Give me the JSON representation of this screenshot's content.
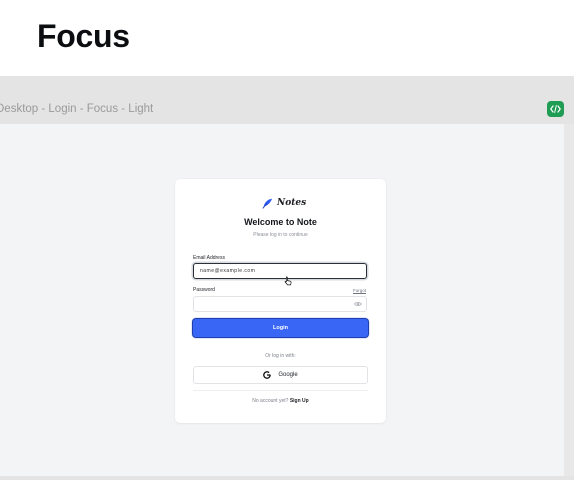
{
  "page": {
    "title": "Focus"
  },
  "frame": {
    "label": "Desktop - Login - Focus - Light"
  },
  "login": {
    "logo_text": "Notes",
    "heading": "Welcome to Note",
    "subheading": "Please log in to continue",
    "email_label": "Email Address",
    "email_value": "name@example.com",
    "password_label": "Password",
    "forgot_label": "Forgot",
    "password_value": "",
    "login_button": "Login",
    "alt_login_text": "Or log in with:",
    "google_button": "Google",
    "no_account_text": "No account yet?",
    "signup_link": "Sign Up"
  },
  "colors": {
    "primary": "#3a66f5",
    "code_badge": "#1f9d55",
    "canvas": "#f3f4f6"
  },
  "icons": [
    "code-icon",
    "feather-icon",
    "cursor-icon",
    "eye-icon",
    "google-icon"
  ]
}
